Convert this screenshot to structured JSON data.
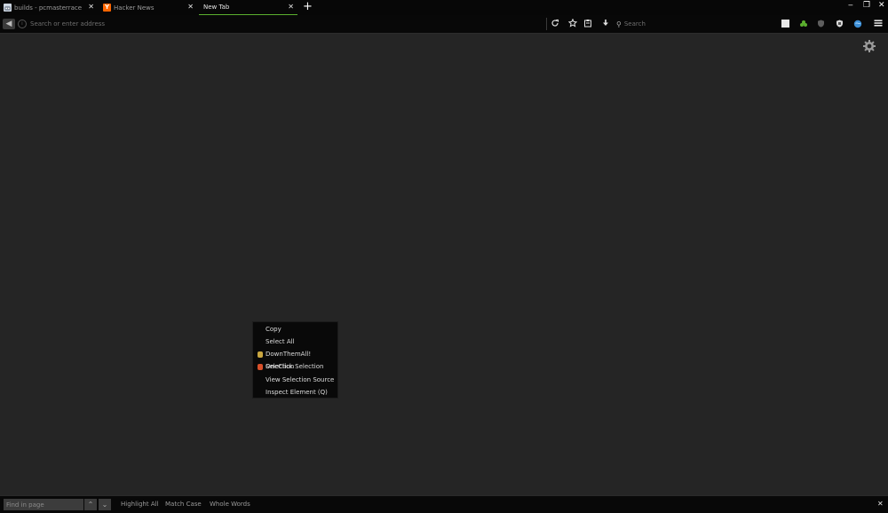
{
  "tabs": [
    {
      "title": "builds - pcmasterrace",
      "favicon": "reddit-icon",
      "favicon_color": "#cfd8e3",
      "active": false
    },
    {
      "title": "Hacker News",
      "favicon": "y-combinator-icon",
      "favicon_color": "#ff6600",
      "favicon_letter": "Y",
      "active": false
    },
    {
      "title": "New Tab",
      "active": true
    }
  ],
  "tab_close_glyph": "✕",
  "new_tab_glyph": "+",
  "window_controls": {
    "minimize": "‒",
    "restore": "❐",
    "close": "✕"
  },
  "navbar": {
    "back_glyph": "◀",
    "url_placeholder": "Search or enter address",
    "search_placeholder": "Search"
  },
  "find_bar": {
    "input_placeholder": "Find in page",
    "prev_glyph": "⌃",
    "next_glyph": "⌄",
    "options": [
      "Highlight All",
      "Match Case",
      "Whole Words"
    ],
    "close_glyph": "✕"
  },
  "context_menu": {
    "items": [
      {
        "label": "Copy",
        "icon": null
      },
      {
        "label": "Select All",
        "icon": null
      },
      {
        "label": "DownThemAll! Selection",
        "icon": "downthemall-icon",
        "icon_color": "#c9a640"
      },
      {
        "label": "OneClick Selection",
        "icon": "oneclick-icon",
        "icon_color": "#d8502a"
      },
      {
        "label": "View Selection Source",
        "icon": null
      },
      {
        "label": "Inspect Element (Q)",
        "icon": null
      }
    ]
  },
  "colors": {
    "content_bg": "#252525",
    "chrome_bg": "#080808",
    "active_tab_accent": "#5bb02e"
  }
}
